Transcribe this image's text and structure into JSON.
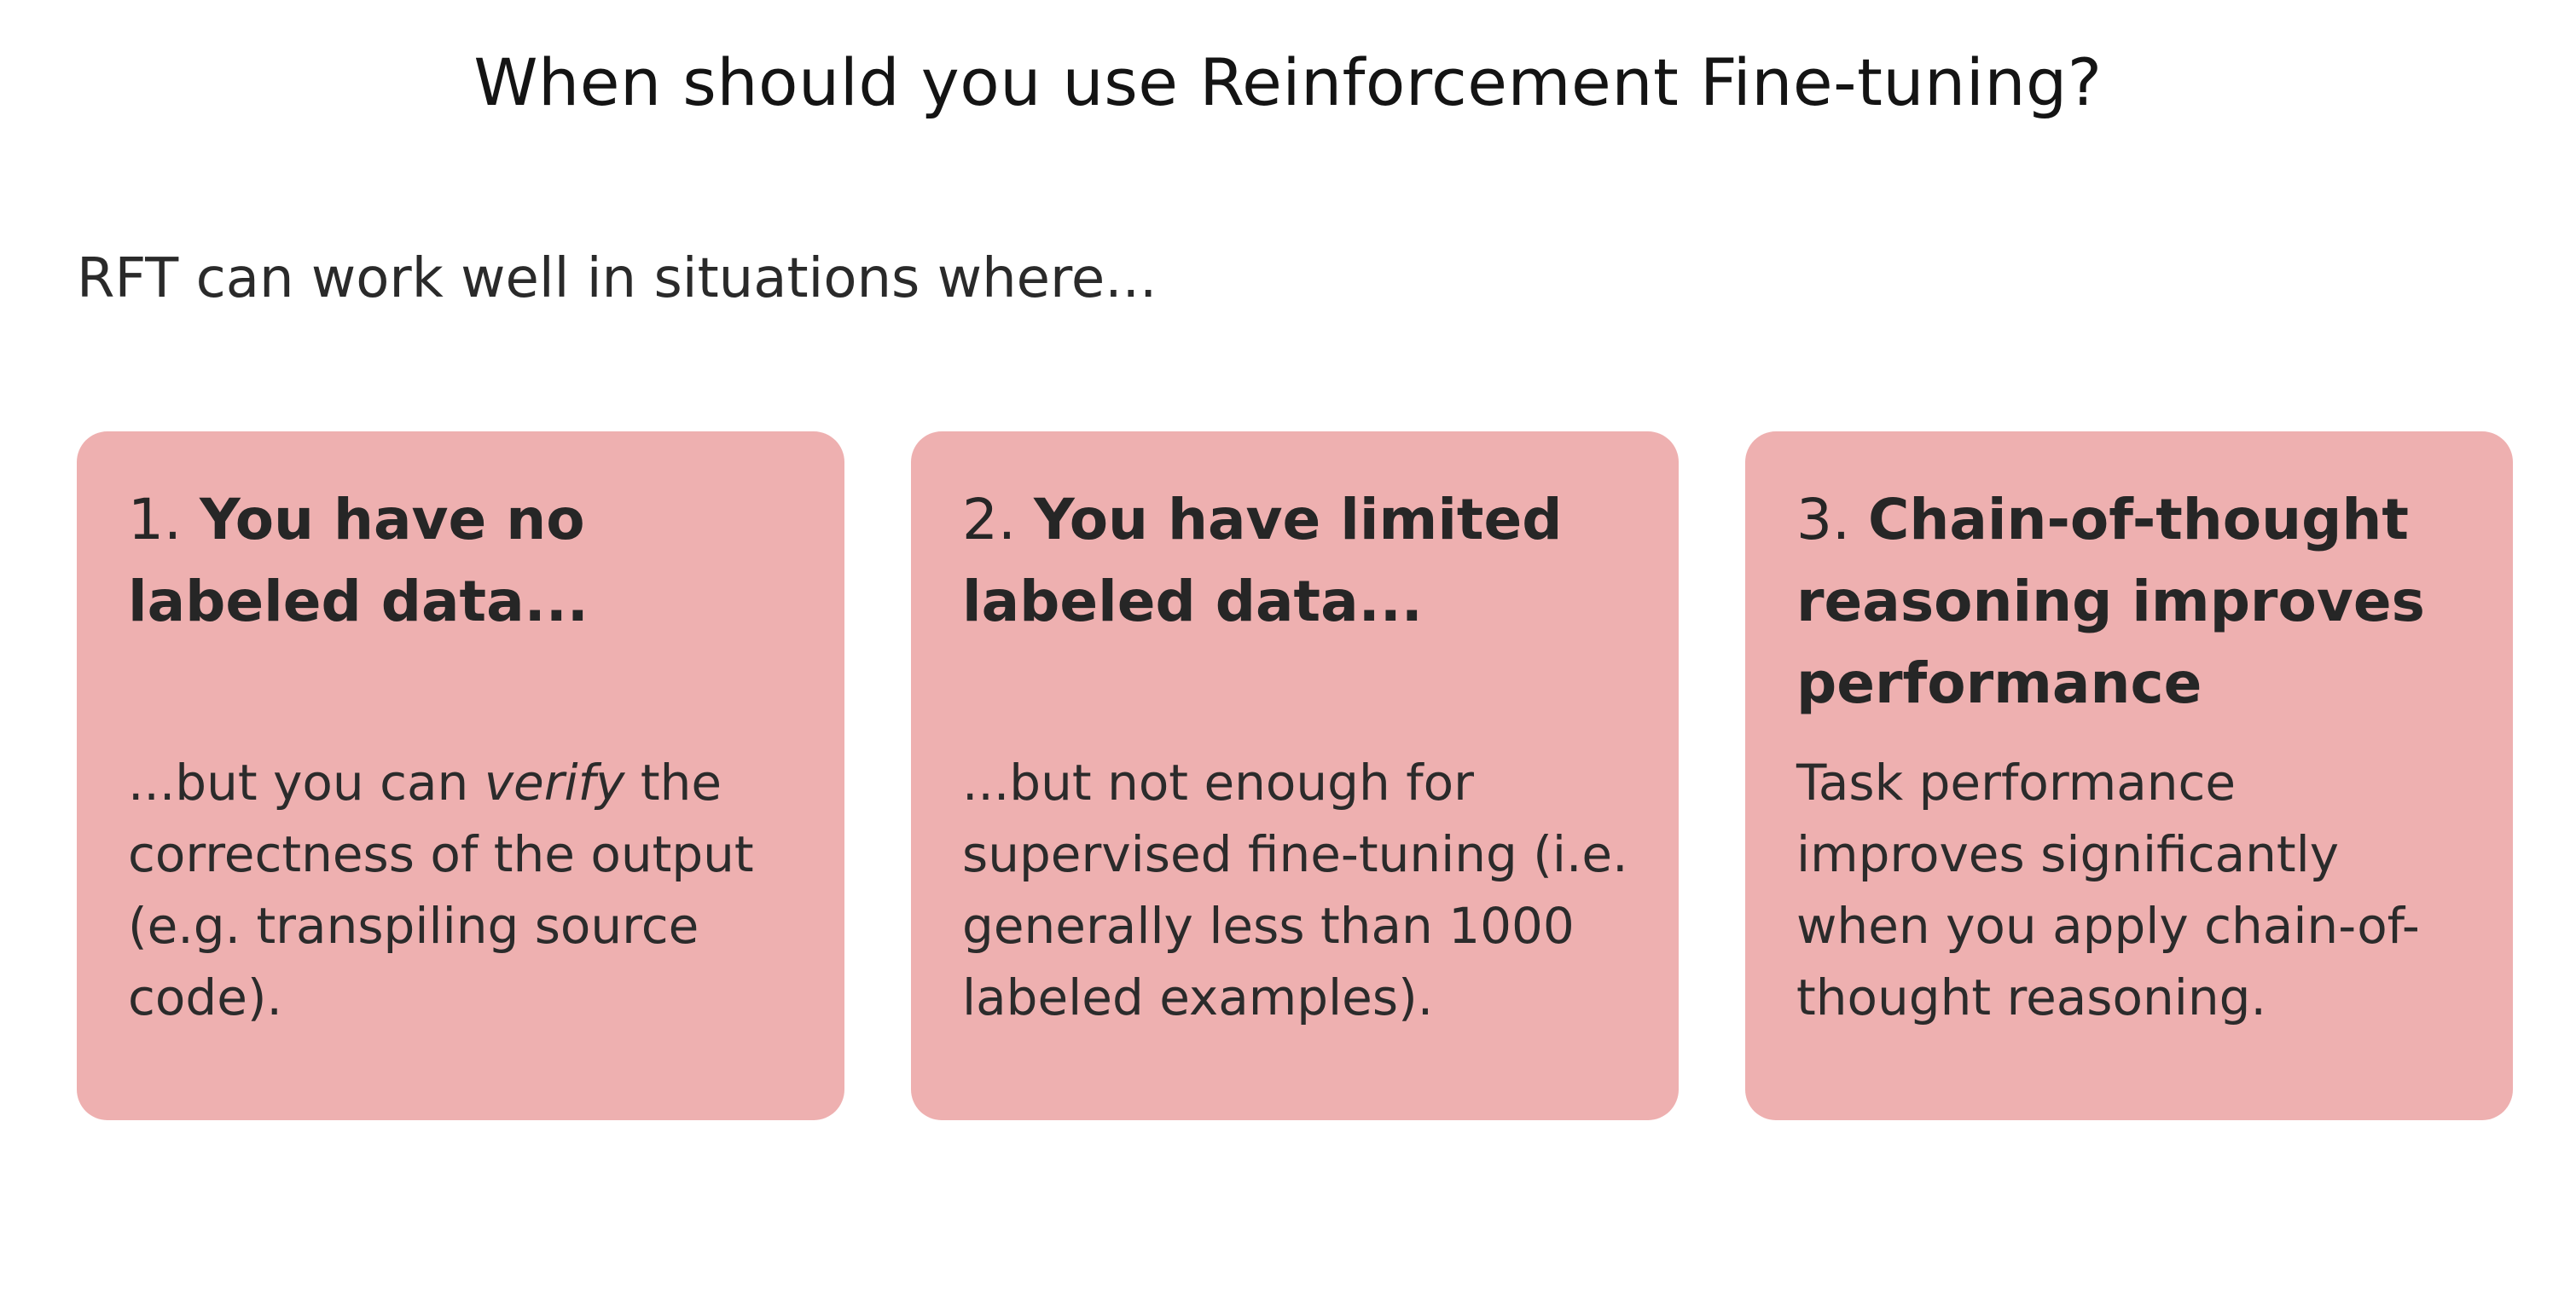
{
  "title": "When should you use Reinforcement Fine-tuning?",
  "intro": "RFT can work well in situations where...",
  "colors": {
    "card_background": "#eeb0b0",
    "text": "#262626",
    "page_background": "#ffffff"
  },
  "cards": [
    {
      "number": "1.",
      "heading": "You have no labeled data...",
      "body_before": "...but you can ",
      "body_emphasis": "verify",
      "body_after": " the correctness of the output (e.g. transpiling source code)."
    },
    {
      "number": "2.",
      "heading": "You have limited labeled data...",
      "body_before": "...but not enough for supervised fine-tuning (i.e. generally less than 1000 labeled examples).",
      "body_emphasis": "",
      "body_after": ""
    },
    {
      "number": "3.",
      "heading": "Chain-of-thought reasoning improves performance",
      "body_before": "Task performance improves significantly when you apply chain-of-thought reasoning.",
      "body_emphasis": "",
      "body_after": ""
    }
  ]
}
